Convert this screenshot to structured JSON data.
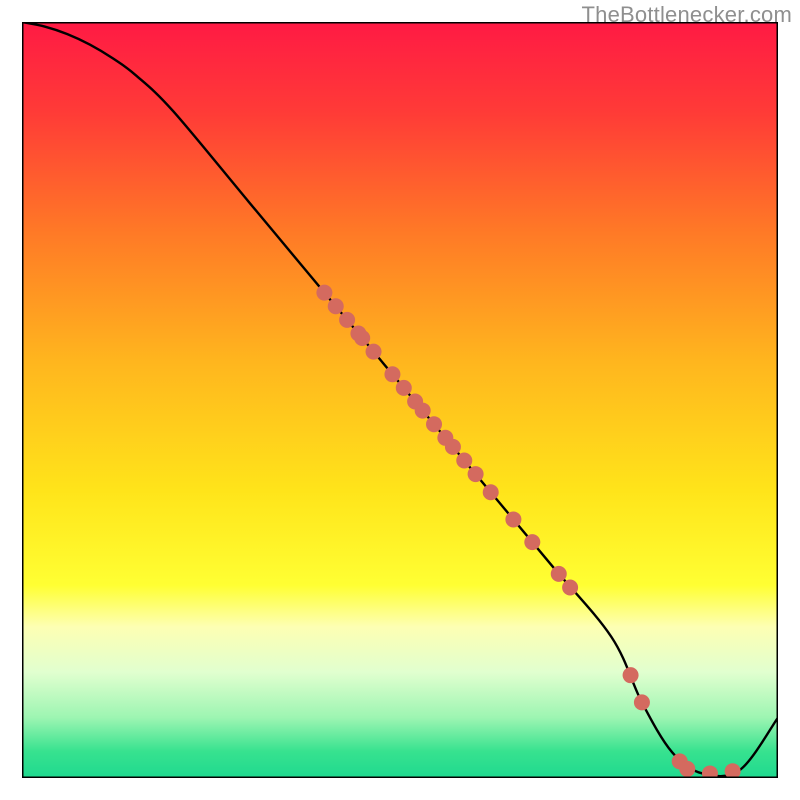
{
  "watermark": "TheBottlenecker.com",
  "chart_data": {
    "type": "line",
    "title": "",
    "xlabel": "",
    "ylabel": "",
    "xlim": [
      0,
      100
    ],
    "ylim": [
      0,
      100
    ],
    "background_gradient": {
      "stops": [
        {
          "offset": 0.0,
          "color": "#ff1a44"
        },
        {
          "offset": 0.12,
          "color": "#ff3b37"
        },
        {
          "offset": 0.28,
          "color": "#ff7a26"
        },
        {
          "offset": 0.45,
          "color": "#ffb61e"
        },
        {
          "offset": 0.62,
          "color": "#ffe41a"
        },
        {
          "offset": 0.745,
          "color": "#ffff33"
        },
        {
          "offset": 0.8,
          "color": "#fdffb3"
        },
        {
          "offset": 0.86,
          "color": "#e1ffcf"
        },
        {
          "offset": 0.92,
          "color": "#9df5b2"
        },
        {
          "offset": 0.965,
          "color": "#37e28f"
        },
        {
          "offset": 1.0,
          "color": "#1fd98f"
        }
      ]
    },
    "curve": {
      "x": [
        0,
        3,
        6,
        9,
        12,
        15,
        20,
        30,
        40,
        50,
        60,
        70,
        78,
        82,
        86,
        90,
        95,
        100
      ],
      "y": [
        100,
        99.4,
        98.4,
        97.0,
        95.2,
        93.0,
        88.2,
        76.2,
        64.2,
        52.2,
        40.2,
        28.2,
        18.6,
        10.0,
        3.4,
        0.6,
        1.1,
        8.0
      ]
    },
    "dots": {
      "color": "#d46a5f",
      "radius_px": 8,
      "points": [
        {
          "x": 40.0,
          "y": 64.2
        },
        {
          "x": 41.5,
          "y": 62.4
        },
        {
          "x": 43.0,
          "y": 60.6
        },
        {
          "x": 44.5,
          "y": 58.8
        },
        {
          "x": 45.0,
          "y": 58.2
        },
        {
          "x": 46.5,
          "y": 56.4
        },
        {
          "x": 49.0,
          "y": 53.4
        },
        {
          "x": 50.5,
          "y": 51.6
        },
        {
          "x": 52.0,
          "y": 49.8
        },
        {
          "x": 53.0,
          "y": 48.6
        },
        {
          "x": 54.5,
          "y": 46.8
        },
        {
          "x": 56.0,
          "y": 45.0
        },
        {
          "x": 57.0,
          "y": 43.8
        },
        {
          "x": 58.5,
          "y": 42.0
        },
        {
          "x": 60.0,
          "y": 40.2
        },
        {
          "x": 62.0,
          "y": 37.8
        },
        {
          "x": 65.0,
          "y": 34.2
        },
        {
          "x": 67.5,
          "y": 31.2
        },
        {
          "x": 71.0,
          "y": 27.0
        },
        {
          "x": 72.5,
          "y": 25.2
        },
        {
          "x": 80.5,
          "y": 13.6
        },
        {
          "x": 82.0,
          "y": 10.0
        },
        {
          "x": 87.0,
          "y": 2.2
        },
        {
          "x": 88.0,
          "y": 1.2
        },
        {
          "x": 91.0,
          "y": 0.6
        },
        {
          "x": 94.0,
          "y": 0.9
        }
      ]
    }
  }
}
